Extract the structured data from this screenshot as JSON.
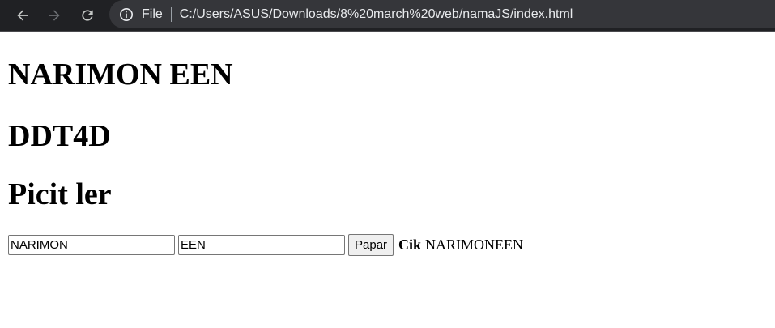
{
  "browser": {
    "scheme_label": "File",
    "url": "C:/Users/ASUS/Downloads/8%20march%20web/namaJS/index.html",
    "chrome_color": "#202124",
    "omnibox_color": "#35363a"
  },
  "page": {
    "name_heading": "NARIMON EEN",
    "class_heading": "DDT4D",
    "hobby_heading": "Picit ler",
    "form": {
      "first_name_value": "NARIMON",
      "last_name_value": "EEN",
      "button_label": "Papar",
      "result_label": "Cik",
      "result_value": "NARIMONEEN"
    }
  }
}
